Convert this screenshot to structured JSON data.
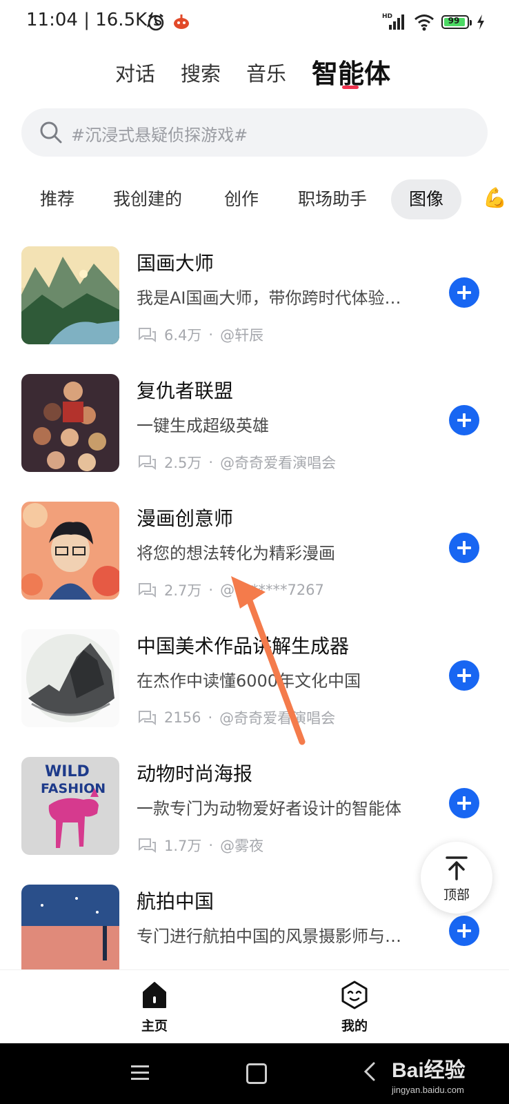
{
  "status": {
    "time": "11:04 | 16.5K/s",
    "battery": "99",
    "icons": [
      "alarm-icon",
      "app-notification-icon",
      "hd-signal-icon",
      "wifi-icon",
      "battery-icon",
      "charging-icon"
    ]
  },
  "top_tabs": [
    {
      "label": "对话",
      "active": false
    },
    {
      "label": "搜索",
      "active": false
    },
    {
      "label": "音乐",
      "active": false
    },
    {
      "label": "智能体",
      "active": true
    }
  ],
  "search": {
    "placeholder": "#沉浸式悬疑侦探游戏#"
  },
  "categories": [
    {
      "label": "推荐",
      "active": false
    },
    {
      "label": "我创建的",
      "active": false
    },
    {
      "label": "创作",
      "active": false
    },
    {
      "label": "职场助手",
      "active": false
    },
    {
      "label": "图像",
      "active": true
    }
  ],
  "agents": [
    {
      "title": "国画大师",
      "desc": "我是AI国画大师，带你跨时代体验…",
      "count": "6.4万",
      "author": "@轩辰"
    },
    {
      "title": "复仇者联盟",
      "desc": "一键生成超级英雄",
      "count": "2.5万",
      "author": "@奇奇爱看演唱会"
    },
    {
      "title": "漫画创意师",
      "desc": "将您的想法转化为精彩漫画",
      "count": "2.7万",
      "author": "@1******7267"
    },
    {
      "title": "中国美术作品讲解生成器",
      "desc": "在杰作中读懂6000年文化中国",
      "count": "2156",
      "author": "@奇奇爱看演唱会"
    },
    {
      "title": "动物时尚海报",
      "desc": "一款专门为动物爱好者设计的智能体",
      "count": "1.7万",
      "author": "@雾夜"
    },
    {
      "title": "航拍中国",
      "desc": "专门进行航拍中国的风景摄影师与…",
      "count": "",
      "author": ""
    }
  ],
  "separator": "·",
  "thumb_text": {
    "wild": "WILD",
    "fashion": "FASHION"
  },
  "to_top": {
    "label": "顶部"
  },
  "bottom_nav": [
    {
      "label": "主页",
      "icon": "home-icon"
    },
    {
      "label": "我的",
      "icon": "profile-face-icon"
    }
  ],
  "watermark": {
    "brand": "Bai经验",
    "url": "jingyan.baidu.com"
  },
  "colors": {
    "accent": "#1866f2",
    "tab_indicator": "#f0334f",
    "arrow": "#f47b4b"
  }
}
